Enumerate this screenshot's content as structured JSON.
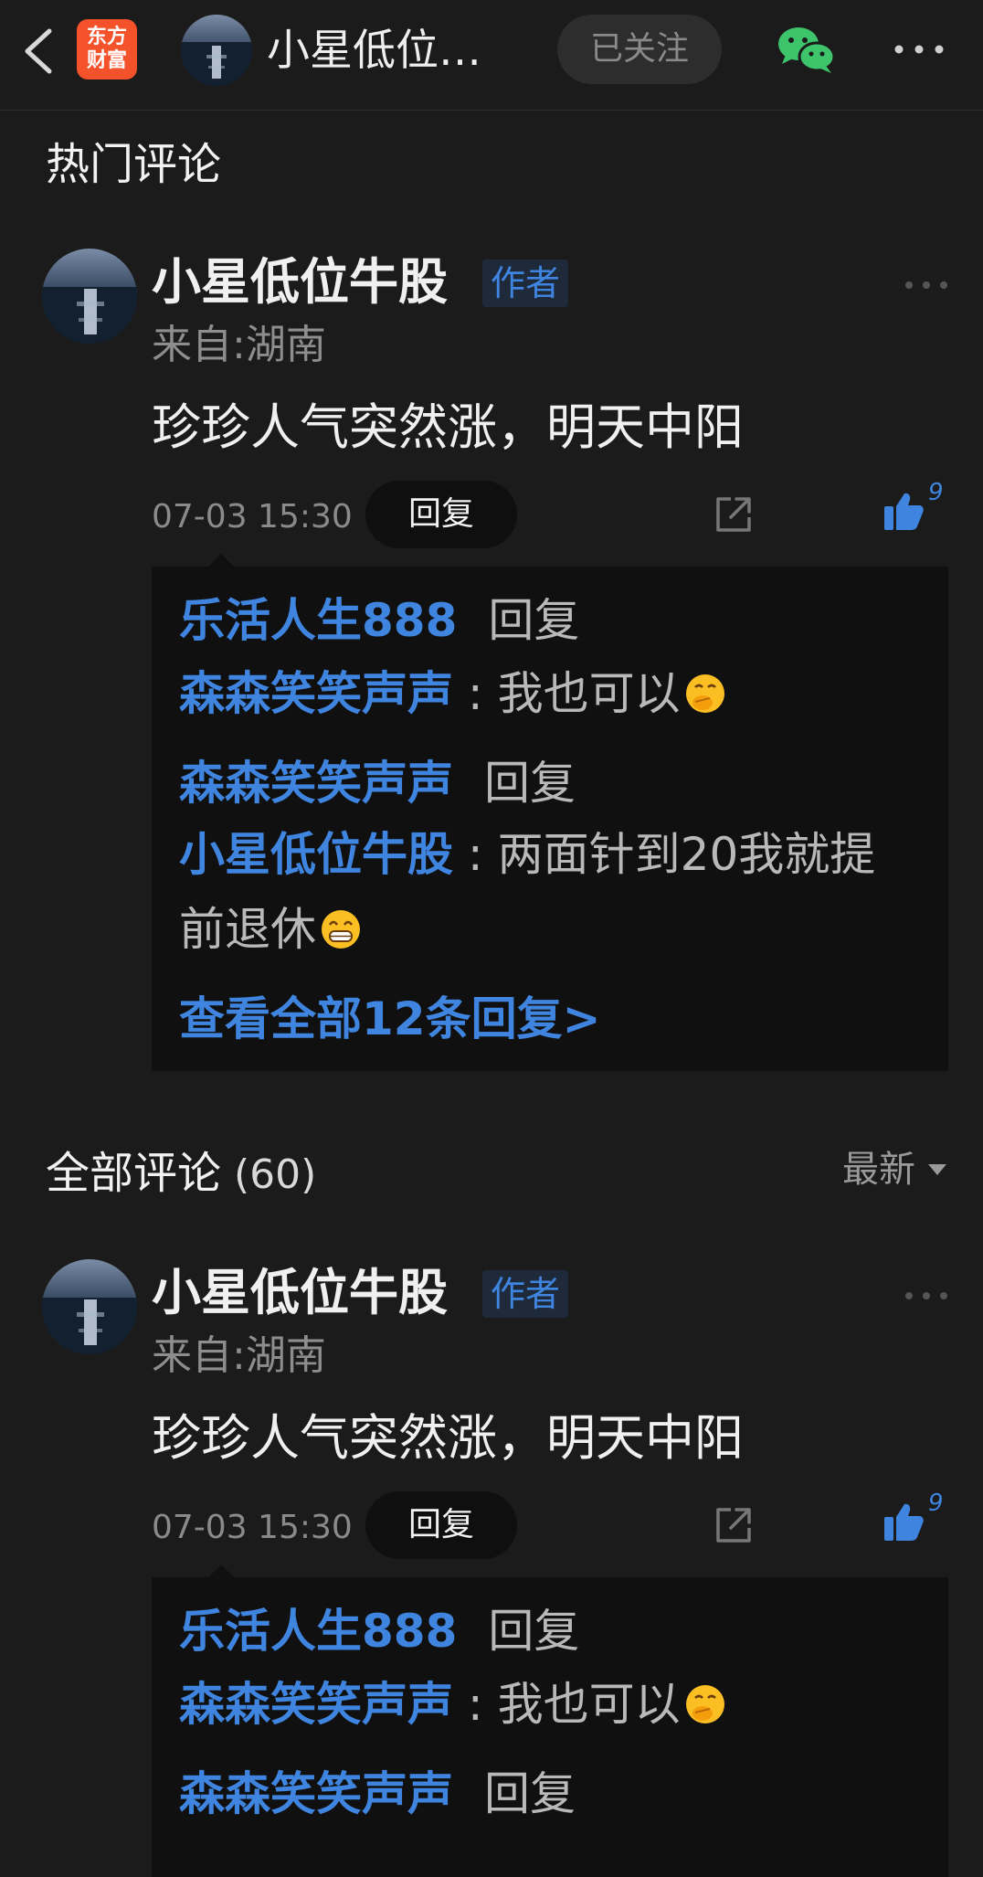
{
  "topbar": {
    "logo_line1": "东方",
    "logo_line2": "财富",
    "title": "小星低位…",
    "follow_label": "已关注",
    "icons": [
      "back-icon",
      "wechat-icon",
      "more-icon"
    ]
  },
  "hot": {
    "title": "热门评论",
    "comment": {
      "author": "小星低位牛股",
      "badge": "作者",
      "location": "来自:湖南",
      "text": "珍珍人气突然涨，明天中阳",
      "time": "07-03 15:30",
      "reply_label": "回复",
      "likes": "9",
      "replies": [
        {
          "from": "乐活人生888",
          "verb": "回复",
          "to": "森森笑笑声声",
          "text": "我也可以",
          "emoji": "hand-over-mouth"
        },
        {
          "from": "森森笑笑声声",
          "verb": "回复",
          "to": "小星低位牛股",
          "text": "两面针到20我就提",
          "text2": "前退休",
          "emoji": "grinning-teeth"
        }
      ],
      "view_all": "查看全部12条回复>"
    }
  },
  "all": {
    "title": "全部评论",
    "count": "(60)",
    "sort_label": "最新",
    "comment": {
      "author": "小星低位牛股",
      "badge": "作者",
      "location": "来自:湖南",
      "text": "珍珍人气突然涨，明天中阳",
      "time": "07-03 15:30",
      "reply_label": "回复",
      "likes": "9",
      "replies": [
        {
          "from": "乐活人生888",
          "verb": "回复",
          "to": "森森笑笑声声",
          "text": "我也可以",
          "emoji": "hand-over-mouth"
        },
        {
          "from": "森森笑笑声声",
          "verb": "回复"
        }
      ]
    }
  },
  "colors": {
    "background": "#1b1b1b",
    "accent": "#3f85e0",
    "brand": "#f4522b"
  }
}
